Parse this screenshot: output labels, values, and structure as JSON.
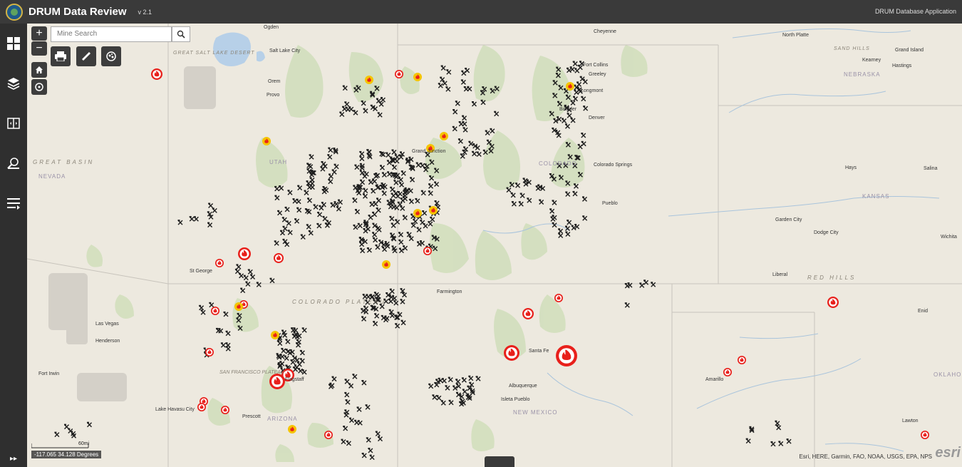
{
  "header": {
    "title": "DRUM Data Review",
    "version": "v 2.1",
    "subtitle": "DRUM Database Application"
  },
  "sidebar": {
    "items": [
      {
        "icon": "grid-icon"
      },
      {
        "icon": "layers-icon"
      },
      {
        "icon": "compare-icon"
      },
      {
        "icon": "search-filter-icon"
      },
      {
        "icon": "list-icon"
      }
    ],
    "expand_label": "▸▸"
  },
  "map_controls": {
    "zoom_in": "+",
    "zoom_out": "−",
    "search_placeholder": "Mine Search",
    "tools": [
      "home-icon",
      "locate-icon",
      "print-icon",
      "measure-icon",
      "layer-toggle-icon"
    ]
  },
  "scale": {
    "label": "60mi"
  },
  "coordinates": "-117.065 34.128 Degrees",
  "attribution": "Esri, HERE, Garmin, FAO, NOAA, USGS, EPA, NPS",
  "esri": "esri",
  "labels": {
    "regions": [
      "GREAT BASIN",
      "COLORADO PLATEAU",
      "RED HILLS",
      "SAND HILLS",
      "GREAT SALT LAKE DESERT",
      "SAN FRANCISCO PLATEAU"
    ],
    "states": [
      "NEVADA",
      "UTAH",
      "COLORADO",
      "ARIZONA",
      "NEW MEXICO",
      "KANSAS",
      "NEBRASKA",
      "OKLAHOMA"
    ],
    "cities": [
      "Ogden",
      "Salt Lake City",
      "Orem",
      "Provo",
      "Cheyenne",
      "Fort Collins",
      "Greeley",
      "Longmont",
      "Boulder",
      "Denver",
      "Colorado Springs",
      "Pueblo",
      "Grand Junction",
      "St George",
      "Las Vegas",
      "Henderson",
      "Farmington",
      "Santa Fe",
      "Albuquerque",
      "Prescott",
      "Lake Havasu City",
      "Amarillo",
      "Garden City",
      "Dodge City",
      "Hays",
      "Salina",
      "Wichita",
      "Liberal",
      "Enid",
      "Lawton",
      "North Platte",
      "Kearney",
      "Grand Island",
      "Hastings",
      "Isleta Pueblo",
      "Flagstaff",
      "Fort Irwin"
    ]
  },
  "colors": {
    "map_bg": "#ede9df",
    "park_green": "#d2dfbd",
    "fire_red": "#e8201b",
    "fire_yellow": "#f5c400",
    "header_bg": "#3a3a3a"
  }
}
